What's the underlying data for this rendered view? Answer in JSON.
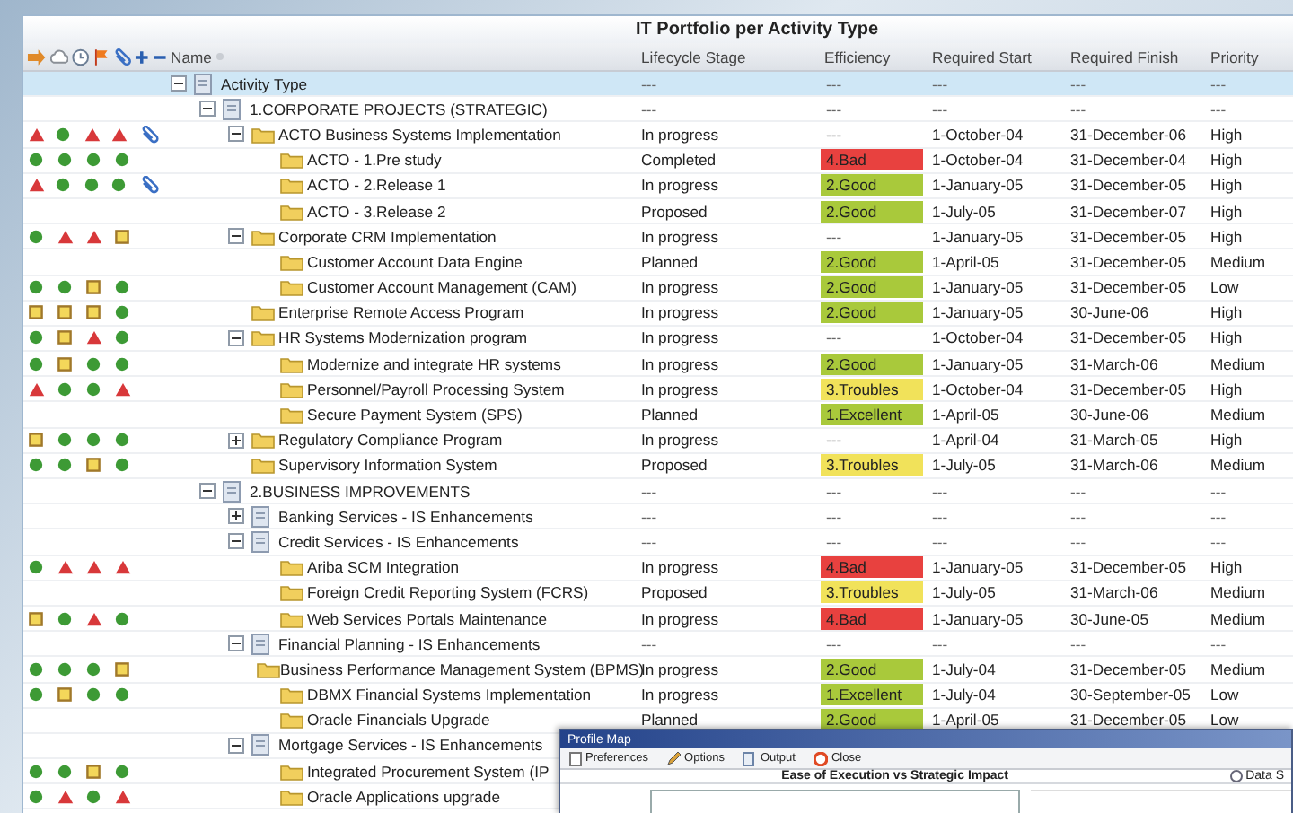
{
  "window": {
    "title": "IT Portfolio per Activity Type"
  },
  "columns": [
    "Name",
    "Lifecycle Stage",
    "Efficiency",
    "Required Start",
    "Required Finish",
    "Priority"
  ],
  "tree": [
    {
      "name": "Activity Type",
      "kind": "document",
      "expanded": true,
      "selected": true,
      "attachment": false,
      "lifecycle": "---",
      "efficiency": {
        "text": "---"
      },
      "start": "---",
      "finish": "---",
      "priority": "---",
      "children": [
        {
          "name": "1.CORPORATE PROJECTS (STRATEGIC)",
          "kind": "document",
          "expanded": true,
          "selected": false,
          "attachment": false,
          "lifecycle": "---",
          "efficiency": {
            "text": "---"
          },
          "start": "---",
          "finish": "---",
          "priority": "---",
          "children": [
            {
              "name": "ACTO Business Systems Implementation",
              "kind": "folder",
              "expanded": true,
              "selected": false,
              "indicators": [
                {
                  "kind": "triangle"
                },
                {
                  "kind": "circle"
                },
                {
                  "kind": "triangle"
                },
                {
                  "kind": "triangle"
                }
              ],
              "attachment": true,
              "lifecycle": "In progress",
              "efficiency": {
                "text": "---"
              },
              "start": "1-October-04",
              "finish": "31-December-06",
              "priority": "High",
              "children": [
                {
                  "name": "ACTO - 1.Pre study",
                  "kind": "folder",
                  "selected": false,
                  "indicators": [
                    {
                      "kind": "circle"
                    },
                    {
                      "kind": "circle"
                    },
                    {
                      "kind": "circle"
                    },
                    {
                      "kind": "circle"
                    }
                  ],
                  "attachment": false,
                  "lifecycle": "Completed",
                  "efficiency": {
                    "text": "4.Bad",
                    "color": "#e8413f"
                  },
                  "start": "1-October-04",
                  "finish": "31-December-04",
                  "priority": "High"
                },
                {
                  "name": "ACTO - 2.Release 1",
                  "kind": "folder",
                  "selected": false,
                  "indicators": [
                    {
                      "kind": "triangle"
                    },
                    {
                      "kind": "circle"
                    },
                    {
                      "kind": "circle"
                    },
                    {
                      "kind": "circle"
                    }
                  ],
                  "attachment": true,
                  "lifecycle": "In progress",
                  "efficiency": {
                    "text": "2.Good",
                    "color": "#a9c93b"
                  },
                  "start": "1-January-05",
                  "finish": "31-December-05",
                  "priority": "High"
                },
                {
                  "name": "ACTO - 3.Release 2",
                  "kind": "folder",
                  "selected": false,
                  "attachment": false,
                  "lifecycle": "Proposed",
                  "efficiency": {
                    "text": "2.Good",
                    "color": "#a9c93b"
                  },
                  "start": "1-July-05",
                  "finish": "31-December-07",
                  "priority": "High"
                }
              ]
            },
            {
              "name": "Corporate CRM Implementation",
              "kind": "folder",
              "expanded": true,
              "selected": false,
              "indicators": [
                {
                  "kind": "circle"
                },
                {
                  "kind": "triangle"
                },
                {
                  "kind": "triangle"
                },
                {
                  "kind": "square"
                }
              ],
              "attachment": false,
              "lifecycle": "In progress",
              "efficiency": {
                "text": "---"
              },
              "start": "1-January-05",
              "finish": "31-December-05",
              "priority": "High",
              "children": [
                {
                  "name": "Customer Account Data Engine",
                  "kind": "folder",
                  "selected": false,
                  "attachment": false,
                  "lifecycle": "Planned",
                  "efficiency": {
                    "text": "2.Good",
                    "color": "#a9c93b"
                  },
                  "start": "1-April-05",
                  "finish": "31-December-05",
                  "priority": "Medium"
                },
                {
                  "name": "Customer Account Management (CAM)",
                  "kind": "folder",
                  "selected": false,
                  "indicators": [
                    {
                      "kind": "circle"
                    },
                    {
                      "kind": "circle"
                    },
                    {
                      "kind": "square"
                    },
                    {
                      "kind": "circle"
                    }
                  ],
                  "attachment": false,
                  "lifecycle": "In progress",
                  "efficiency": {
                    "text": "2.Good",
                    "color": "#a9c93b"
                  },
                  "start": "1-January-05",
                  "finish": "31-December-05",
                  "priority": "Low"
                }
              ]
            },
            {
              "name": "Enterprise Remote Access Program",
              "kind": "folder",
              "selected": false,
              "indicators": [
                {
                  "kind": "square"
                },
                {
                  "kind": "square"
                },
                {
                  "kind": "square"
                },
                {
                  "kind": "circle"
                }
              ],
              "attachment": false,
              "lifecycle": "In progress",
              "efficiency": {
                "text": "2.Good",
                "color": "#a9c93b"
              },
              "start": "1-January-05",
              "finish": "30-June-06",
              "priority": "High"
            },
            {
              "name": "HR Systems Modernization program",
              "kind": "folder",
              "expanded": true,
              "selected": false,
              "indicators": [
                {
                  "kind": "circle"
                },
                {
                  "kind": "square"
                },
                {
                  "kind": "triangle"
                },
                {
                  "kind": "circle"
                }
              ],
              "attachment": false,
              "lifecycle": "In progress",
              "efficiency": {
                "text": "---"
              },
              "start": "1-October-04",
              "finish": "31-December-05",
              "priority": "High",
              "children": [
                {
                  "name": "Modernize and integrate HR systems",
                  "kind": "folder",
                  "selected": false,
                  "indicators": [
                    {
                      "kind": "circle"
                    },
                    {
                      "kind": "square"
                    },
                    {
                      "kind": "circle"
                    },
                    {
                      "kind": "circle"
                    }
                  ],
                  "attachment": false,
                  "lifecycle": "In progress",
                  "efficiency": {
                    "text": "2.Good",
                    "color": "#a9c93b"
                  },
                  "start": "1-January-05",
                  "finish": "31-March-06",
                  "priority": "Medium"
                },
                {
                  "name": "Personnel/Payroll Processing System",
                  "kind": "folder",
                  "selected": false,
                  "indicators": [
                    {
                      "kind": "triangle"
                    },
                    {
                      "kind": "circle"
                    },
                    {
                      "kind": "circle"
                    },
                    {
                      "kind": "triangle"
                    }
                  ],
                  "attachment": false,
                  "lifecycle": "In progress",
                  "efficiency": {
                    "text": "3.Troubles",
                    "color": "#f1e25a"
                  },
                  "start": "1-October-04",
                  "finish": "31-December-05",
                  "priority": "High"
                },
                {
                  "name": "Secure Payment System (SPS)",
                  "kind": "folder",
                  "selected": false,
                  "attachment": false,
                  "lifecycle": "Planned",
                  "efficiency": {
                    "text": "1.Excellent",
                    "color": "#a9c93b"
                  },
                  "start": "1-April-05",
                  "finish": "30-June-06",
                  "priority": "Medium"
                }
              ]
            },
            {
              "name": "Regulatory Compliance Program",
              "kind": "folder",
              "expanded": false,
              "selected": false,
              "indicators": [
                {
                  "kind": "square"
                },
                {
                  "kind": "circle"
                },
                {
                  "kind": "circle"
                },
                {
                  "kind": "circle"
                }
              ],
              "attachment": false,
              "lifecycle": "In progress",
              "efficiency": {
                "text": "---"
              },
              "start": "1-April-04",
              "finish": "31-March-05",
              "priority": "High"
            },
            {
              "name": "Supervisory Information System",
              "kind": "folder",
              "selected": false,
              "indicators": [
                {
                  "kind": "circle"
                },
                {
                  "kind": "circle"
                },
                {
                  "kind": "square"
                },
                {
                  "kind": "circle"
                }
              ],
              "attachment": false,
              "lifecycle": "Proposed",
              "efficiency": {
                "text": "3.Troubles",
                "color": "#f1e25a"
              },
              "start": "1-July-05",
              "finish": "31-March-06",
              "priority": "Medium"
            }
          ]
        },
        {
          "name": "2.BUSINESS IMPROVEMENTS",
          "kind": "document",
          "expanded": true,
          "selected": false,
          "attachment": false,
          "lifecycle": "---",
          "efficiency": {
            "text": "---"
          },
          "start": "---",
          "finish": "---",
          "priority": "---",
          "children": [
            {
              "name": "Banking Services - IS Enhancements",
              "kind": "document",
              "expanded": false,
              "selected": false,
              "attachment": false,
              "lifecycle": "---",
              "efficiency": {
                "text": "---"
              },
              "start": "---",
              "finish": "---",
              "priority": "---"
            },
            {
              "name": "Credit Services - IS Enhancements",
              "kind": "document",
              "expanded": true,
              "selected": false,
              "attachment": false,
              "lifecycle": "---",
              "efficiency": {
                "text": "---"
              },
              "start": "---",
              "finish": "---",
              "priority": "---",
              "children": [
                {
                  "name": "Ariba SCM Integration",
                  "kind": "folder",
                  "selected": false,
                  "indicators": [
                    {
                      "kind": "circle"
                    },
                    {
                      "kind": "triangle"
                    },
                    {
                      "kind": "triangle"
                    },
                    {
                      "kind": "triangle"
                    }
                  ],
                  "attachment": false,
                  "lifecycle": "In progress",
                  "efficiency": {
                    "text": "4.Bad",
                    "color": "#e8413f"
                  },
                  "start": "1-January-05",
                  "finish": "31-December-05",
                  "priority": "High"
                },
                {
                  "name": "Foreign Credit Reporting System (FCRS)",
                  "kind": "folder",
                  "selected": false,
                  "attachment": false,
                  "lifecycle": "Proposed",
                  "efficiency": {
                    "text": "3.Troubles",
                    "color": "#f1e25a"
                  },
                  "start": "1-July-05",
                  "finish": "31-March-06",
                  "priority": "Medium"
                },
                {
                  "name": "Web Services Portals Maintenance",
                  "kind": "folder",
                  "selected": false,
                  "indicators": [
                    {
                      "kind": "square"
                    },
                    {
                      "kind": "circle"
                    },
                    {
                      "kind": "triangle"
                    },
                    {
                      "kind": "circle"
                    }
                  ],
                  "attachment": false,
                  "lifecycle": "In progress",
                  "efficiency": {
                    "text": "4.Bad",
                    "color": "#e8413f"
                  },
                  "start": "1-January-05",
                  "finish": "30-June-05",
                  "priority": "Medium"
                }
              ]
            },
            {
              "name": "Financial Planning - IS Enhancements",
              "kind": "document",
              "expanded": true,
              "selected": false,
              "attachment": false,
              "lifecycle": "---",
              "efficiency": {
                "text": "---"
              },
              "start": "---",
              "finish": "---",
              "priority": "---",
              "children": [
                {
                  "name": "Business Performance Management System (BPMS)",
                  "kind": "folder",
                  "selected": false,
                  "indicators": [
                    {
                      "kind": "circle"
                    },
                    {
                      "kind": "circle"
                    },
                    {
                      "kind": "circle"
                    },
                    {
                      "kind": "square"
                    }
                  ],
                  "attachment": false,
                  "lifecycle": "In progress",
                  "efficiency": {
                    "text": "2.Good",
                    "color": "#a9c93b"
                  },
                  "start": "1-July-04",
                  "finish": "31-December-05",
                  "priority": "Medium"
                },
                {
                  "name": "DBMX Financial Systems Implementation",
                  "kind": "folder",
                  "selected": false,
                  "indicators": [
                    {
                      "kind": "circle"
                    },
                    {
                      "kind": "square"
                    },
                    {
                      "kind": "circle"
                    },
                    {
                      "kind": "circle"
                    }
                  ],
                  "attachment": false,
                  "lifecycle": "In progress",
                  "efficiency": {
                    "text": "1.Excellent",
                    "color": "#a9c93b"
                  },
                  "start": "1-July-04",
                  "finish": "30-September-05",
                  "priority": "Low"
                },
                {
                  "name": "Oracle Financials Upgrade",
                  "kind": "folder",
                  "selected": false,
                  "attachment": false,
                  "lifecycle": "Planned",
                  "efficiency": {
                    "text": "2.Good",
                    "color": "#a9c93b"
                  },
                  "start": "1-April-05",
                  "finish": "31-December-05",
                  "priority": "Low"
                }
              ]
            },
            {
              "name": "Mortgage Services - IS Enhancements",
              "kind": "document",
              "expanded": true,
              "selected": false,
              "attachment": false,
              "children": [
                {
                  "name": "Integrated Procurement System (IP",
                  "kind": "folder",
                  "selected": false,
                  "indicators": [
                    {
                      "kind": "circle"
                    },
                    {
                      "kind": "circle"
                    },
                    {
                      "kind": "square"
                    },
                    {
                      "kind": "circle"
                    }
                  ],
                  "attachment": false
                },
                {
                  "name": "Oracle Applications upgrade",
                  "kind": "folder",
                  "selected": false,
                  "indicators": [
                    {
                      "kind": "circle"
                    },
                    {
                      "kind": "triangle"
                    },
                    {
                      "kind": "circle"
                    },
                    {
                      "kind": "triangle"
                    }
                  ],
                  "attachment": false
                }
              ]
            }
          ]
        }
      ]
    }
  ],
  "profile_map": {
    "title": "Profile Map",
    "toolbar": [
      {
        "kind": "preferences",
        "label": "Preferences"
      },
      {
        "kind": "options",
        "label": "Options"
      },
      {
        "kind": "output",
        "label": "Output"
      },
      {
        "kind": "close",
        "label": "Close"
      }
    ],
    "chart_title": "Ease of Execution vs Strategic Impact",
    "side_label": "Data S"
  }
}
